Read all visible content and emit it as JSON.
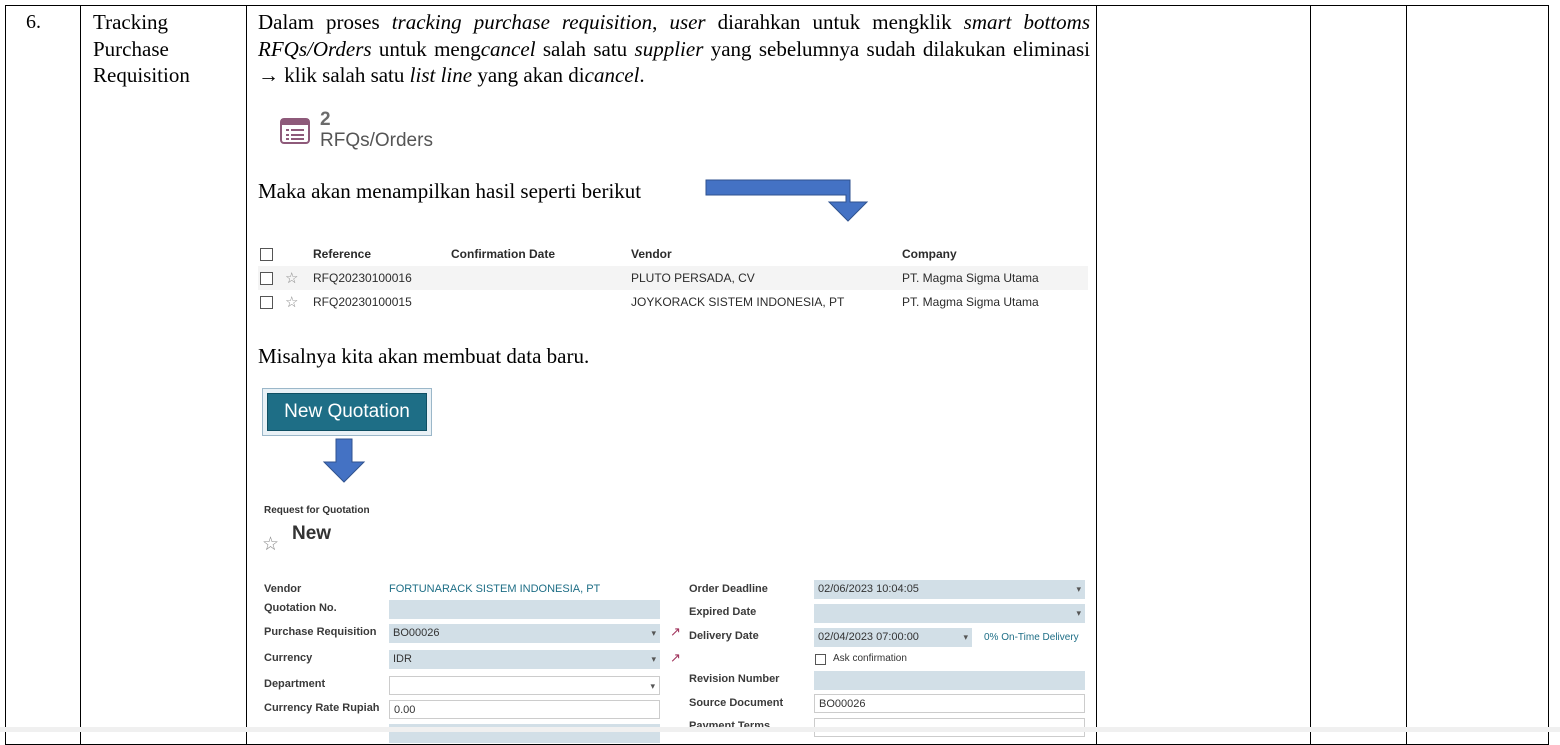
{
  "row": {
    "number": "6.",
    "title_lines": [
      "Tracking",
      "Purchase",
      "Requisition"
    ]
  },
  "paragraph": {
    "p1": "Dalam proses ",
    "p1_i": "tracking purchase requisition",
    "p2": ", ",
    "p2_i": "user",
    "p3": " diarahkan untuk mengklik ",
    "p3_i": "smart bottoms RFQs/Orders",
    "p4": " untuk meng",
    "p4_i": "cancel",
    "p5": " salah satu ",
    "p5_i": "supplier",
    "p6": " yang sebelumnya sudah dilakukan eliminasi ",
    "arrow": "→",
    "p7": " klik salah satu ",
    "p7_i": "list line",
    "p8": " yang akan di",
    "p8_i": "cancel",
    "p9": "."
  },
  "smart_button": {
    "count": "2",
    "label": "RFQs/Orders",
    "icon": "list-icon"
  },
  "text_result": "Maka akan menampilkan hasil seperti berikut",
  "list": {
    "headers": [
      "Reference",
      "Confirmation Date",
      "Vendor",
      "Company"
    ],
    "rows": [
      {
        "reference": "RFQ20230100016",
        "confirmation_date": "",
        "vendor": "PLUTO PERSADA, CV",
        "company": "PT. Magma Sigma Utama"
      },
      {
        "reference": "RFQ20230100015",
        "confirmation_date": "",
        "vendor": "JOYKORACK SISTEM INDONESIA, PT",
        "company": "PT. Magma Sigma Utama"
      }
    ]
  },
  "text_new": "Misalnya kita akan membuat data baru.",
  "new_button": "New Quotation",
  "form": {
    "subtitle": "Request for Quotation",
    "title": "New",
    "left": {
      "vendor_label": "Vendor",
      "vendor_value": "FORTUNARACK SISTEM INDONESIA, PT",
      "quotation_label": "Quotation No.",
      "quotation_value": "",
      "pr_label": "Purchase Requisition",
      "pr_value": "BO00026",
      "currency_label": "Currency",
      "currency_value": "IDR",
      "department_label": "Department",
      "department_value": "",
      "rate_label": "Currency Rate Rupiah",
      "rate_value": "0.00"
    },
    "right": {
      "deadline_label": "Order Deadline",
      "deadline_value": "02/06/2023 10:04:05",
      "expired_label": "Expired Date",
      "expired_value": "",
      "delivery_label": "Delivery Date",
      "delivery_value": "02/04/2023 07:00:00",
      "ontime_text": "0% On-Time Delivery",
      "ask_label": "Ask confirmation",
      "revision_label": "Revision Number",
      "revision_value": "",
      "source_label": "Source Document",
      "source_value": "BO00026",
      "payment_label": "Payment Terms"
    }
  },
  "colors": {
    "accent": "#1e6e86",
    "arrow_blue": "#4472c4",
    "input_bg": "#d2dfe7"
  }
}
